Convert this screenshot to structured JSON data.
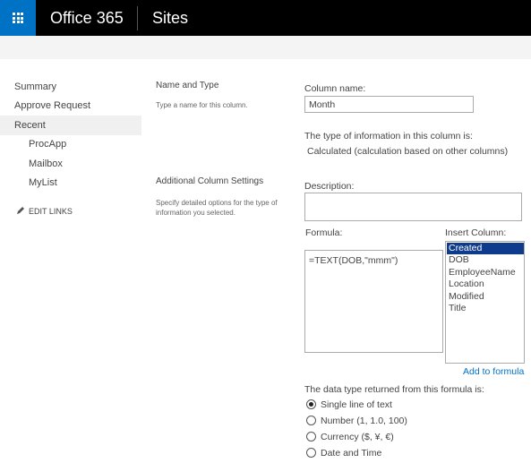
{
  "suitebar": {
    "brand": "Office 365",
    "app": "Sites",
    "app_launcher_icon": "waffle-icon",
    "accent": "#0072c6"
  },
  "nav": {
    "items": [
      "Summary",
      "Approve Request",
      "Recent"
    ],
    "recent_items": [
      "ProcApp",
      "Mailbox",
      "MyList"
    ],
    "edit_links": "EDIT LINKS",
    "edit_icon": "pencil-icon"
  },
  "name_type": {
    "title": "Name and Type",
    "desc": "Type a name for this column.",
    "column_name_label": "Column name:",
    "column_name_value": "Month",
    "type_label": "The type of information in this column is:",
    "type_value": "Calculated (calculation based on other columns)"
  },
  "additional": {
    "title": "Additional Column Settings",
    "desc": "Specify detailed options for the type of information you selected.",
    "description_label": "Description:",
    "description_value": "",
    "formula_label": "Formula:",
    "formula_value": "=TEXT(DOB,\"mmm\")",
    "insert_column_label": "Insert Column:",
    "columns": [
      "Created",
      "DOB",
      "EmployeeName",
      "Location",
      "Modified",
      "Title"
    ],
    "selected_column": "Created",
    "add_to_formula": "Add to formula",
    "return_type_label": "The data type returned from this formula is:",
    "return_types": [
      "Single line of text",
      "Number (1, 1.0, 100)",
      "Currency ($, ¥, €)",
      "Date and Time"
    ],
    "selected_return_type": "Single line of text"
  }
}
